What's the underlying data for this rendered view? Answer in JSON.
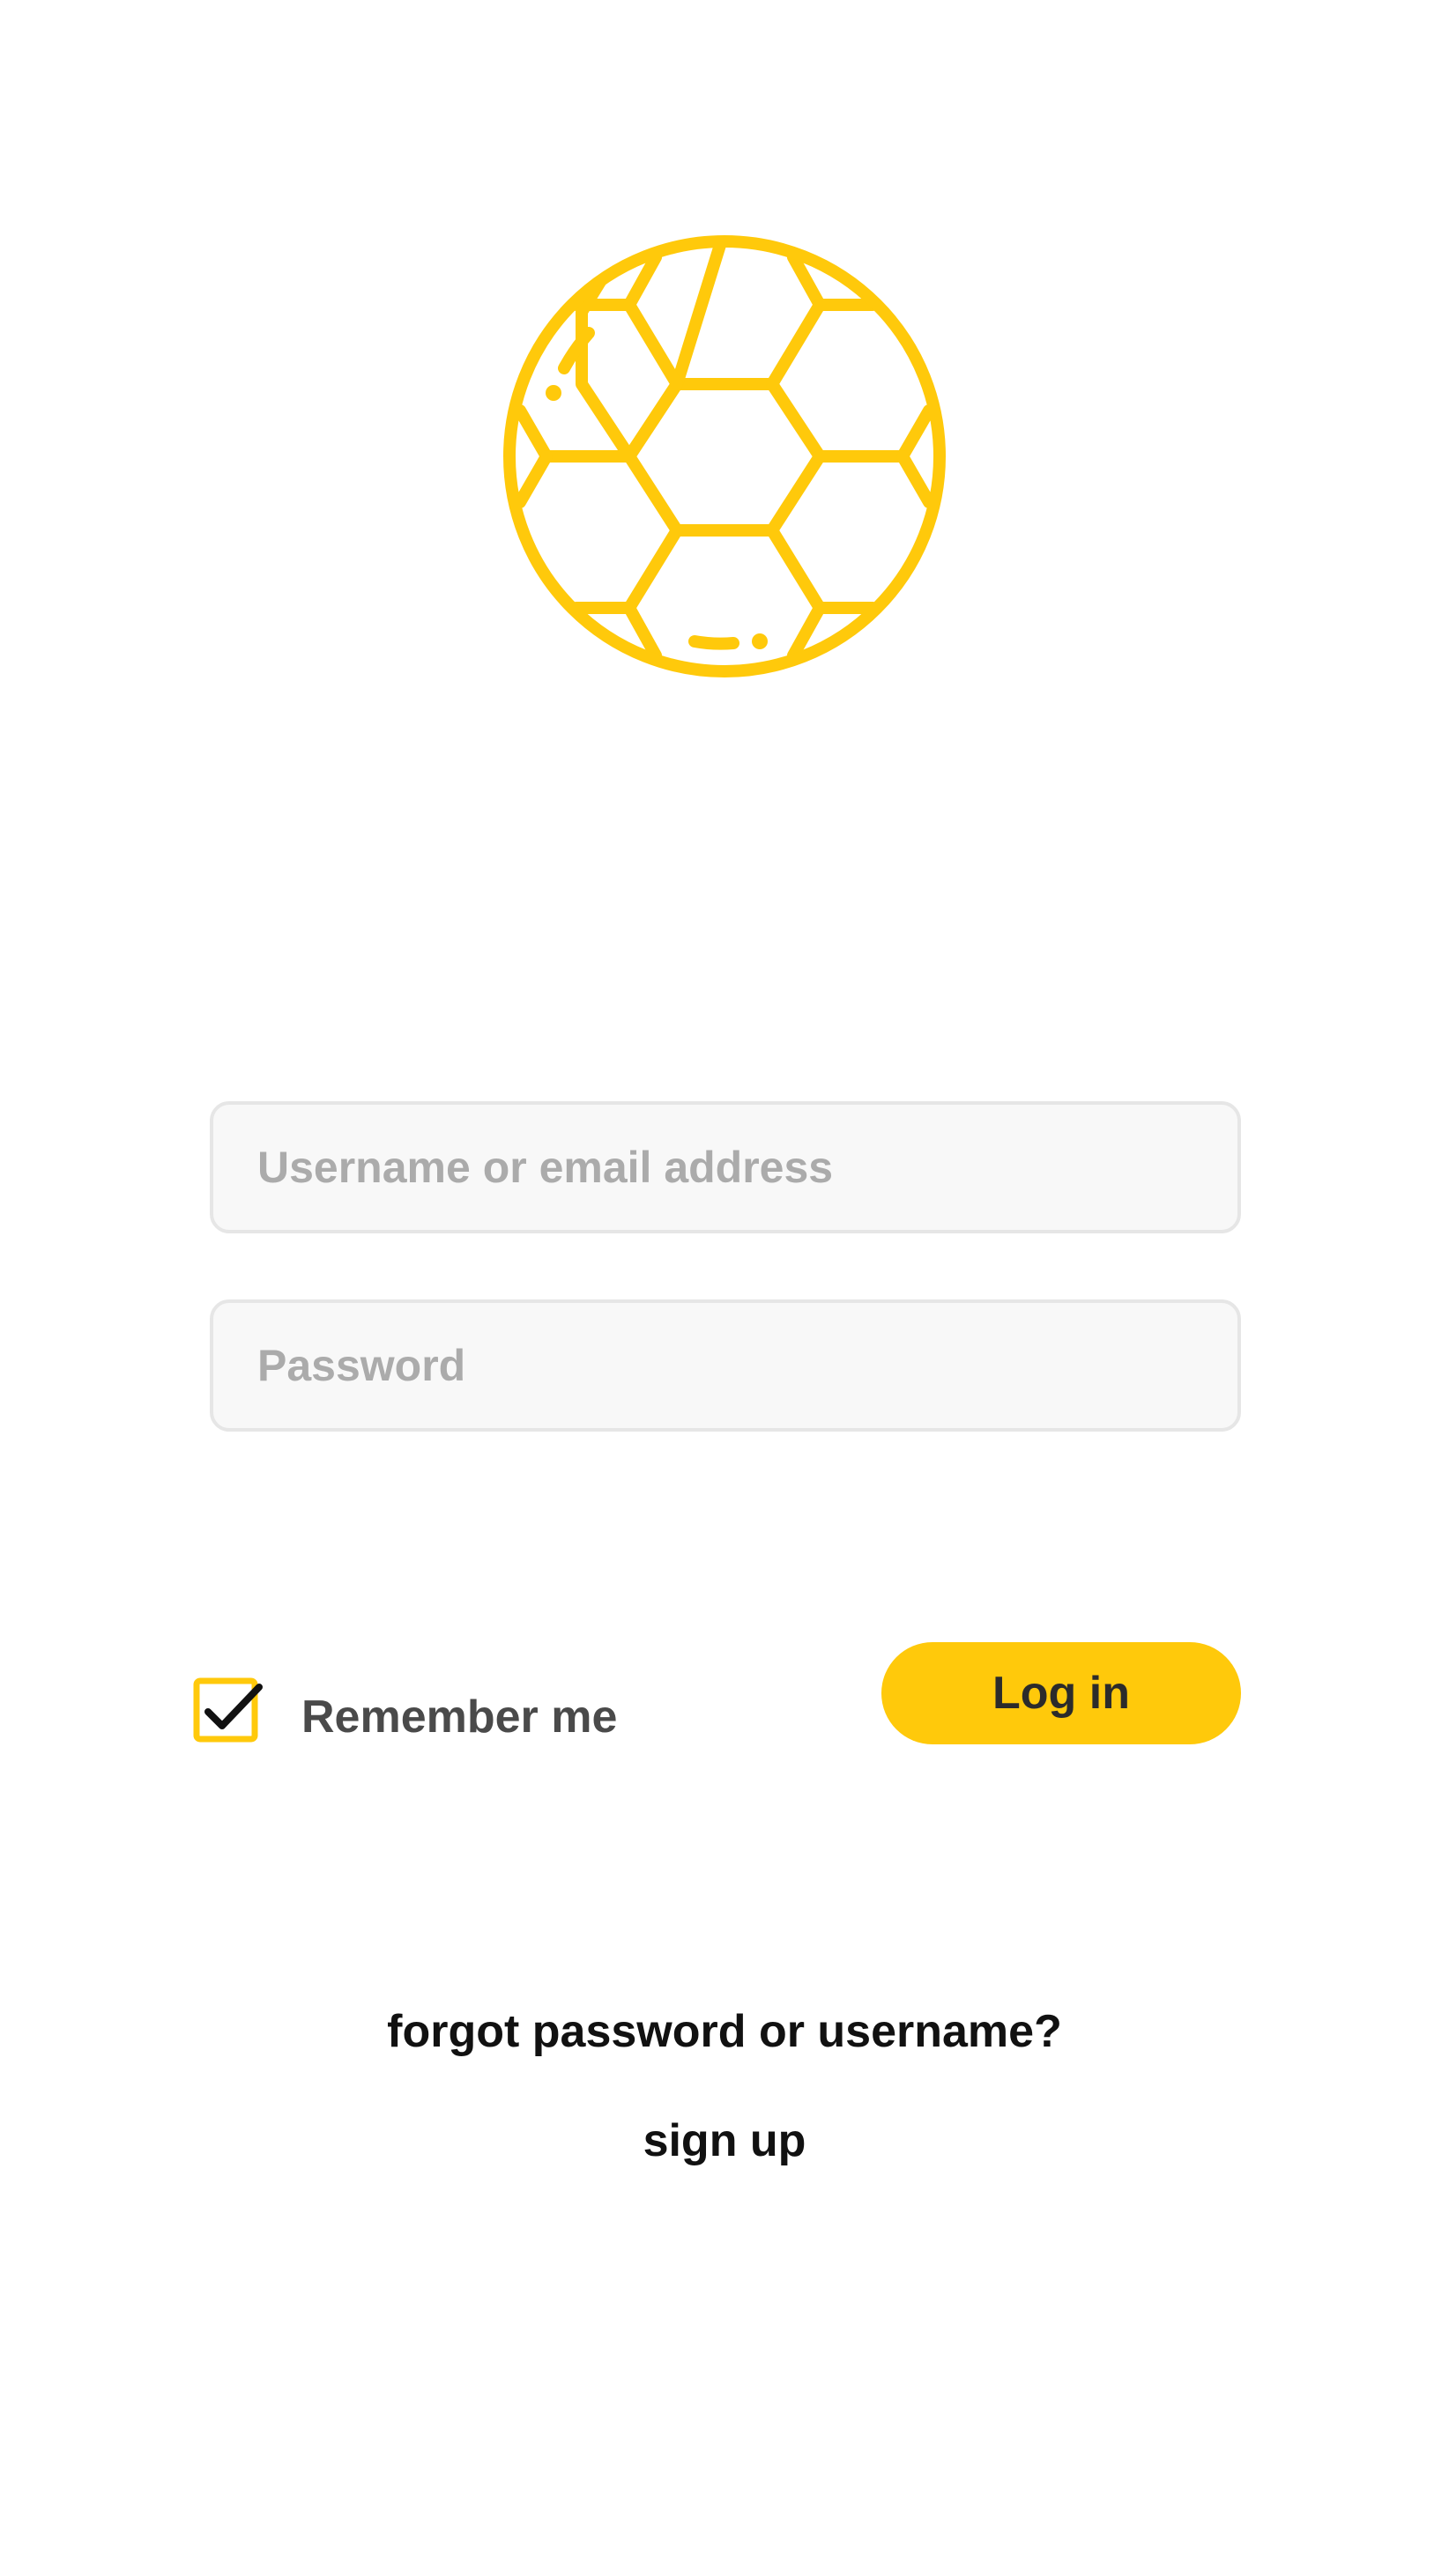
{
  "brand": {
    "logo_icon": "soccer-ball-icon",
    "accent_color": "#ffc90b"
  },
  "login_form": {
    "username": {
      "placeholder": "Username or email address",
      "value": ""
    },
    "password": {
      "placeholder": "Password",
      "value": ""
    },
    "remember_me": {
      "label": "Remember me",
      "checked": true,
      "icon": "checkmark-icon"
    },
    "login_button_label": "Log in"
  },
  "links": {
    "forgot": "forgot password or username?",
    "signup": "sign up"
  }
}
